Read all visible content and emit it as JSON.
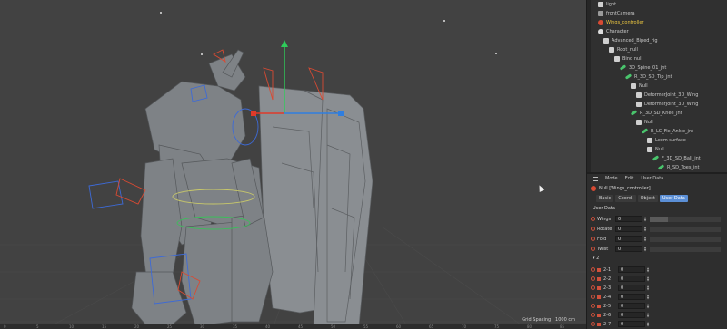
{
  "viewport": {
    "grid_spacing": "Grid Spacing : 1000 cm",
    "ruler_ticks": [
      "0",
      "5",
      "10",
      "15",
      "20",
      "25",
      "30",
      "35",
      "40",
      "45",
      "50",
      "55",
      "60",
      "65",
      "70",
      "75",
      "80",
      "85"
    ]
  },
  "object_manager": {
    "items": [
      {
        "label": "light",
        "icon": "light-icon",
        "highlight": false
      },
      {
        "label": "frontCamera",
        "icon": "camera-icon",
        "highlight": false
      },
      {
        "label": "Wings_controller",
        "icon": "controller-icon",
        "highlight": true
      },
      {
        "label": "Character",
        "icon": "character-icon",
        "highlight": false
      },
      {
        "label": "Advanced_Biped_rig",
        "icon": "null-icon",
        "highlight": false
      },
      {
        "label": "Root_null",
        "icon": "null-icon",
        "highlight": false
      },
      {
        "label": "Bind null",
        "icon": "null-icon",
        "highlight": false
      },
      {
        "label": "3D_Spine_01_jnt",
        "icon": "bone-icon",
        "highlight": false
      },
      {
        "label": "R_3D_SD_Tip_jnt",
        "icon": "bone-icon",
        "highlight": false
      },
      {
        "label": "Null",
        "icon": "null-icon",
        "highlight": false
      },
      {
        "label": "DeformerJoint_3D_Wing",
        "icon": "null-icon",
        "highlight": false
      },
      {
        "label": "DeformerJoint_3D_Wing",
        "icon": "null-icon",
        "highlight": false
      },
      {
        "label": "R_3D_SD_Knee_jnt",
        "icon": "bone-icon",
        "highlight": false
      },
      {
        "label": "Null",
        "icon": "null-icon",
        "highlight": false
      },
      {
        "label": "R_LC_Fix_Ankle_jnt",
        "icon": "bone-icon",
        "highlight": false
      },
      {
        "label": "Leem surface",
        "icon": "null-icon",
        "highlight": false
      },
      {
        "label": "Null",
        "icon": "null-icon",
        "highlight": false
      },
      {
        "label": "F_3D_SD_Ball_jnt",
        "icon": "bone-icon",
        "highlight": false
      },
      {
        "label": "R_SD_Toes_jnt",
        "icon": "bone-icon",
        "highlight": false
      }
    ]
  },
  "attribute_manager": {
    "menu": [
      "Mode",
      "Edit",
      "User Data"
    ],
    "object_label": "Null [Wings_controller]",
    "tabs": [
      "Basic",
      "Coord.",
      "Object",
      "User Data"
    ],
    "active_tab": "User Data",
    "section_title": "User Data",
    "rows": [
      {
        "label": "Wings",
        "value": "0",
        "fill": 0.25
      },
      {
        "label": "Rotate",
        "value": "0",
        "fill": 0
      },
      {
        "label": "Fold",
        "value": "0",
        "fill": 0
      },
      {
        "label": "Twist",
        "value": "0",
        "fill": 0
      }
    ],
    "group_label": "2",
    "group_rows": [
      {
        "label": "2-1",
        "value": "0"
      },
      {
        "label": "2-2",
        "value": "0"
      },
      {
        "label": "2-3",
        "value": "0"
      },
      {
        "label": "2-4",
        "value": "0"
      },
      {
        "label": "2-5",
        "value": "0"
      },
      {
        "label": "2-6",
        "value": "0"
      },
      {
        "label": "2-7",
        "value": "0"
      }
    ]
  },
  "colors": {
    "accent": "#5b8fd6",
    "highlight": "#e9c440",
    "axis_x": "#e03a2a",
    "axis_y": "#2ecc5a",
    "axis_z": "#2f7ee0"
  }
}
